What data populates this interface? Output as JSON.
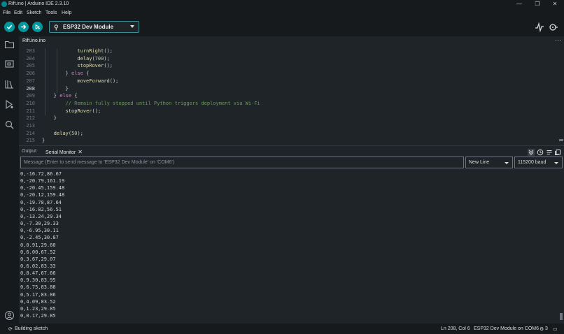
{
  "window": {
    "title": "Rift.ino | Arduino IDE 2.3.10"
  },
  "menu": [
    "File",
    "Edit",
    "Sketch",
    "Tools",
    "Help"
  ],
  "toolbar": {
    "board": "ESP32 Dev Module"
  },
  "editor": {
    "tab": "Rift.ino.ino",
    "active_line": "208",
    "lines": [
      {
        "n": "203",
        "indent": 3
      },
      {
        "n": "204",
        "indent": 3
      },
      {
        "n": "205",
        "indent": 3
      },
      {
        "n": "206",
        "indent": 2
      },
      {
        "n": "207",
        "indent": 3
      },
      {
        "n": "208",
        "indent": 2
      },
      {
        "n": "209",
        "indent": 1
      },
      {
        "n": "210",
        "indent": 2
      },
      {
        "n": "211",
        "indent": 2
      },
      {
        "n": "212",
        "indent": 1
      },
      {
        "n": "213",
        "indent": 0
      },
      {
        "n": "214",
        "indent": 1
      },
      {
        "n": "215",
        "indent": 0
      }
    ],
    "code": [
      "turnRight();",
      "delay(700);",
      "stopRover();",
      "} else {",
      "moveForward();",
      "}",
      "} else {",
      "// Remain fully stopped until Python triggers deployment via Wi-Fi",
      "stopRover();",
      "}",
      "",
      "delay(50);",
      "}"
    ]
  },
  "panel": {
    "tabs": [
      "Output",
      "Serial Monitor"
    ],
    "message_placeholder": "Message (Enter to send message to 'ESP32 Dev Module' on 'COM6')",
    "line_ending": "New Line",
    "baud": "115200 baud",
    "serial_lines": [
      "0,-16.72,86.67",
      "0,-20.79,161.19",
      "0,-20.45,159.48",
      "0,-20.12,159.48",
      "0,-19.78,87.64",
      "0,-16.82,56.51",
      "0,-13.24,29.34",
      "0,-7.30,29.33",
      "0,-6.95,30.11",
      "0,-2.45,30.87",
      "0,0.91,29.60",
      "0,6.00,67.52",
      "0,3.67,29.07",
      "0,6.02,83.33",
      "0,8.47,67.66",
      "0,9.30,83.95",
      "0,6.75,83.88",
      "0,5.17,83.86",
      "0,4.09,83.52",
      "0,1.23,29.85",
      "0,0.17,29.85"
    ]
  },
  "status": {
    "building": "Building sketch",
    "cursor": "Ln 208, Col 6",
    "board_port": "ESP32 Dev Module on COM6",
    "notifications": "3"
  },
  "colors": {
    "accent": "#00878f",
    "background": "#1f2428",
    "chrome": "#161a1d"
  }
}
